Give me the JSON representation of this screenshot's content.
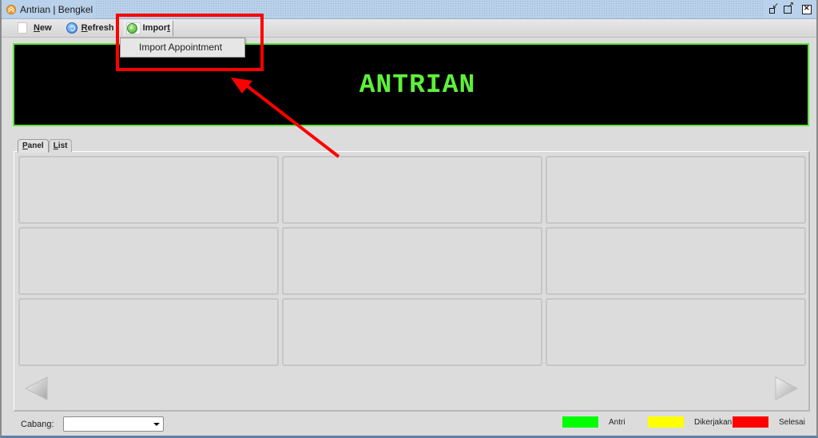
{
  "window": {
    "title": "Antrian | Bengkel",
    "controls": [
      "restore-icon",
      "maximize-icon",
      "close-icon"
    ]
  },
  "toolbar": {
    "new_label_u": "N",
    "new_label_rest": "ew",
    "refresh_label_u": "R",
    "refresh_label_rest": "efresh",
    "import_label_pre": "Impor",
    "import_label_u": "t",
    "import_menu": {
      "open": true,
      "items": [
        {
          "label": "Import Appointment"
        }
      ]
    }
  },
  "banner": {
    "text": "ANTRIAN",
    "text_color": "#5ef03a",
    "background": "#000000",
    "border_color": "#5ee33a"
  },
  "tabs": [
    {
      "label_u": "P",
      "label_rest": "anel",
      "active": true
    },
    {
      "label_u": "L",
      "label_rest": "ist",
      "active": false
    }
  ],
  "panel": {
    "cells": [
      "",
      "",
      "",
      "",
      "",
      "",
      "",
      "",
      ""
    ],
    "prev_icon": "triangle-left-icon",
    "next_icon": "triangle-right-icon"
  },
  "status": {
    "cabang_label": "Cabang:",
    "cabang_value": "",
    "legend": [
      {
        "label": "Antri",
        "color": "#00ff00"
      },
      {
        "label": "Dikerjakan",
        "color": "#ffff00"
      },
      {
        "label": "Selesai",
        "color": "#ff0000"
      }
    ]
  },
  "annotation": {
    "highlight_color": "#ff0000",
    "target": "Import Appointment menu"
  }
}
